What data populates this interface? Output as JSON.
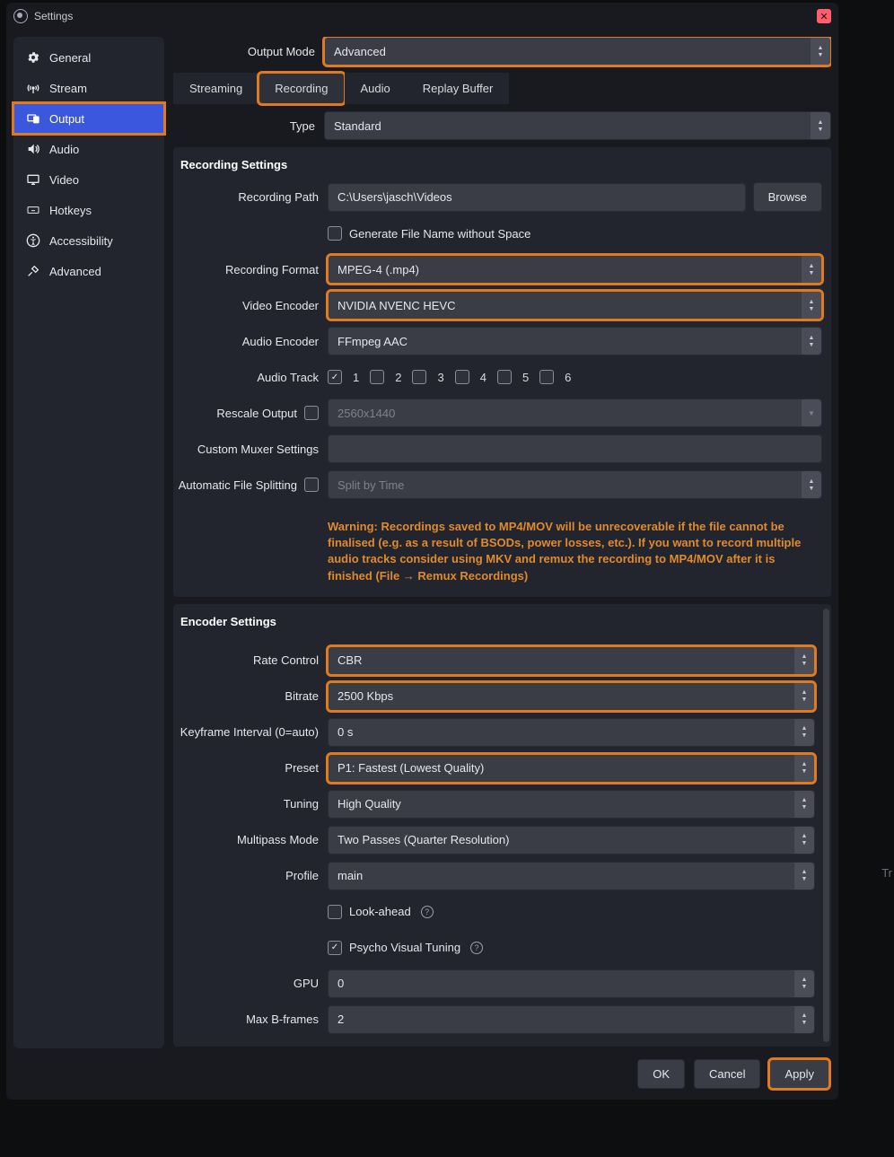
{
  "window": {
    "title": "Settings"
  },
  "sidebar": {
    "items": [
      {
        "label": "General"
      },
      {
        "label": "Stream"
      },
      {
        "label": "Output"
      },
      {
        "label": "Audio"
      },
      {
        "label": "Video"
      },
      {
        "label": "Hotkeys"
      },
      {
        "label": "Accessibility"
      },
      {
        "label": "Advanced"
      }
    ]
  },
  "outputMode": {
    "label": "Output Mode",
    "value": "Advanced"
  },
  "tabs": {
    "streaming": "Streaming",
    "recording": "Recording",
    "audio": "Audio",
    "replayBuffer": "Replay Buffer"
  },
  "type": {
    "label": "Type",
    "value": "Standard"
  },
  "recording": {
    "heading": "Recording Settings",
    "path": {
      "label": "Recording Path",
      "value": "C:\\Users\\jasch\\Videos",
      "browse": "Browse"
    },
    "genNoSpace": "Generate File Name without Space",
    "format": {
      "label": "Recording Format",
      "value": "MPEG-4 (.mp4)"
    },
    "videoEnc": {
      "label": "Video Encoder",
      "value": "NVIDIA NVENC HEVC"
    },
    "audioEnc": {
      "label": "Audio Encoder",
      "value": "FFmpeg AAC"
    },
    "audioTrack": {
      "label": "Audio Track",
      "t1": "1",
      "t2": "2",
      "t3": "3",
      "t4": "4",
      "t5": "5",
      "t6": "6"
    },
    "rescale": {
      "label": "Rescale Output",
      "value": "2560x1440"
    },
    "muxer": {
      "label": "Custom Muxer Settings",
      "value": ""
    },
    "split": {
      "label": "Automatic File Splitting",
      "value": "Split by Time"
    },
    "warning": "Warning: Recordings saved to MP4/MOV will be unrecoverable if the file cannot be finalised (e.g. as a result of BSODs, power losses, etc.). If you want to record multiple audio tracks consider using MKV and remux the recording to MP4/MOV after it is finished (File → Remux Recordings)"
  },
  "encoder": {
    "heading": "Encoder Settings",
    "rateControl": {
      "label": "Rate Control",
      "value": "CBR"
    },
    "bitrate": {
      "label": "Bitrate",
      "value": "2500 Kbps"
    },
    "keyframe": {
      "label": "Keyframe Interval (0=auto)",
      "value": "0 s"
    },
    "preset": {
      "label": "Preset",
      "value": "P1: Fastest (Lowest Quality)"
    },
    "tuning": {
      "label": "Tuning",
      "value": "High Quality"
    },
    "multipass": {
      "label": "Multipass Mode",
      "value": "Two Passes (Quarter Resolution)"
    },
    "profile": {
      "label": "Profile",
      "value": "main"
    },
    "lookahead": "Look-ahead",
    "psycho": "Psycho Visual Tuning",
    "gpu": {
      "label": "GPU",
      "value": "0"
    },
    "maxb": {
      "label": "Max B-frames",
      "value": "2"
    }
  },
  "footer": {
    "ok": "OK",
    "cancel": "Cancel",
    "apply": "Apply"
  },
  "cutoff": "Tr"
}
